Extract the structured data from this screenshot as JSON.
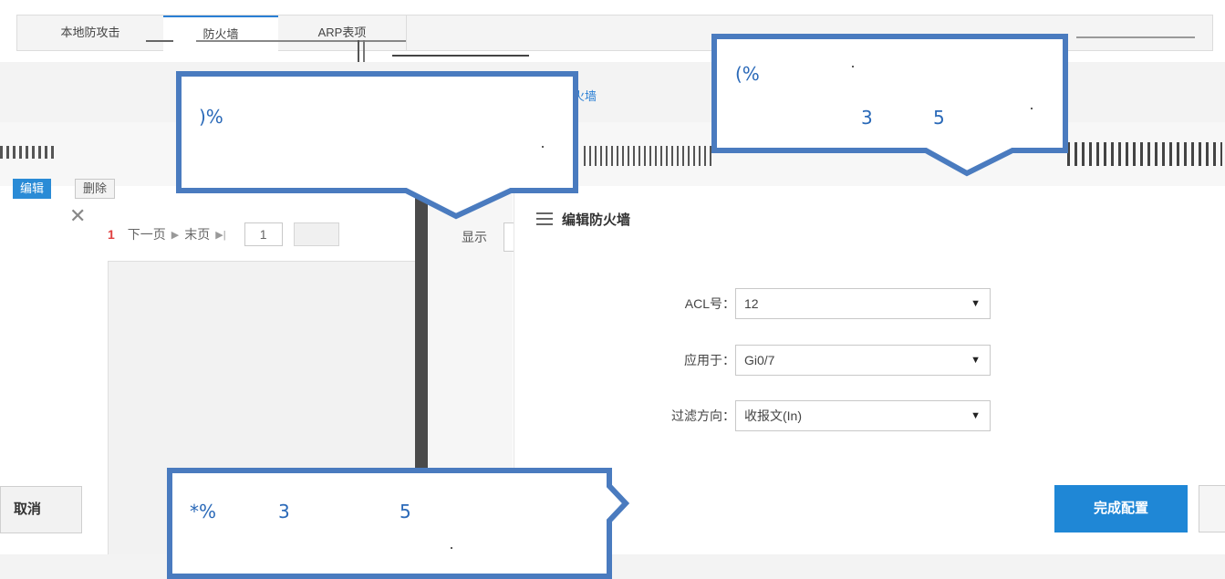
{
  "tabs": [
    {
      "label": "本地防攻击"
    },
    {
      "label": "防火墙"
    },
    {
      "label": "ARP表项"
    }
  ],
  "breadcrumb": {
    "current": "火墙"
  },
  "toolbar": {
    "edit_label": "编辑",
    "delete_label": "删除"
  },
  "pager": {
    "current_page": "1",
    "next_label": "下一页",
    "last_label": "末页",
    "page_input": "1"
  },
  "mid": {
    "show_label": "显示"
  },
  "modal": {
    "title": "编辑防火墙",
    "fields": {
      "acl": {
        "label": "ACL号：",
        "value": "12"
      },
      "apply_to": {
        "label": "应用于：",
        "value": "Gi0/7"
      },
      "direction": {
        "label": "过滤方向：",
        "value": "收报文(In)"
      }
    },
    "finish_label": "完成配置"
  },
  "footer": {
    "cancel_label": "取消"
  },
  "callouts": {
    "top_left": {
      "text": ")%"
    },
    "top_right": {
      "line1": "(%",
      "line2a": "3",
      "line2b": "5"
    },
    "bottom": {
      "a": "*%",
      "b": "3",
      "c": "5"
    }
  },
  "colors": {
    "accent": "#1f87d6",
    "callout_border": "#4a7bbf",
    "callout_text": "#2a69b8"
  }
}
